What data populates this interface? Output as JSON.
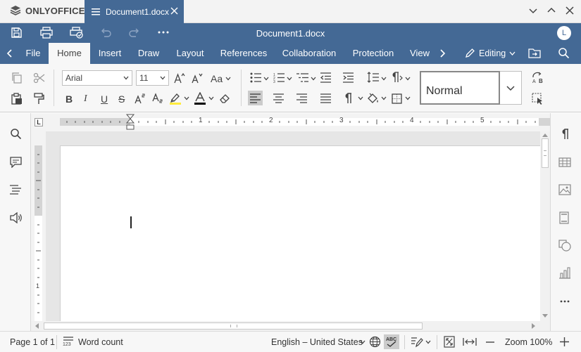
{
  "app": {
    "brand": "ONLYOFFICE",
    "document_name": "Document1.docx",
    "user_initial": "L"
  },
  "tabs": [
    "File",
    "Home",
    "Insert",
    "Draw",
    "Layout",
    "References",
    "Collaboration",
    "Protection",
    "View"
  ],
  "active_tab": "Home",
  "mode": {
    "label": "Editing"
  },
  "toolbar": {
    "font_name": "Arial",
    "font_size": "11",
    "change_case_label": "Aa",
    "style_name": "Normal",
    "bold_label": "B",
    "italic_label": "I",
    "underline_label": "U",
    "strike_label": "S"
  },
  "ruler": {
    "numbers": [
      "1",
      "2",
      "3",
      "4",
      "5"
    ],
    "tab_stop_label": "L"
  },
  "status": {
    "page": "Page 1 of 1",
    "word_count": "Word count",
    "word_count_icon_text": "123",
    "language": "English – United States",
    "zoom": "Zoom 100%"
  },
  "colors": {
    "header": "#446995",
    "toolbar_bg": "#f7f7f7",
    "highlight": "#ffeb3b",
    "font_color": "#000000"
  }
}
